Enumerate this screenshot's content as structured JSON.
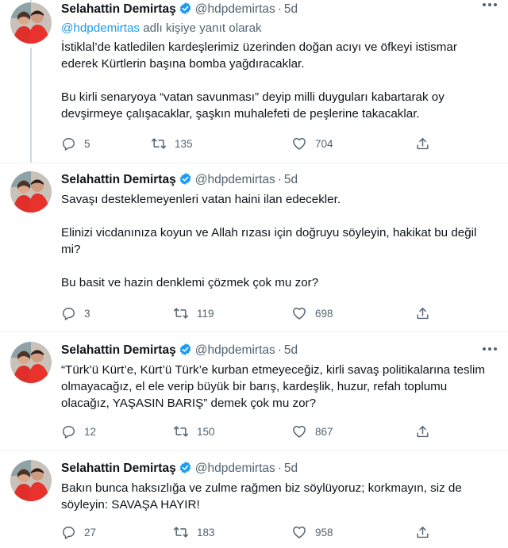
{
  "author": {
    "name": "Selahattin Demirtaş",
    "handle": "@hdpdemirtas",
    "time": "5d",
    "dot": "·"
  },
  "colors": {
    "link": "#1d9bf0",
    "verified": "#1d9bf0",
    "secondary": "#536471"
  },
  "tweets": [
    {
      "reply_to": {
        "handle": "@hdpdemirtas",
        "suffix": " adlı kişiye yanıt olarak"
      },
      "paragraphs": [
        "İstiklal’de katledilen kardeşlerimiz üzerinden doğan acıyı ve öfkeyi istismar ederek Kürtlerin başına bomba yağdıracaklar.",
        "Bu kirli senaryoya “vatan savunması” deyip milli duyguları kabartarak oy devşirmeye çalışacaklar, şaşkın muhalefeti de peşlerine takacaklar."
      ],
      "replies": "5",
      "retweets": "135",
      "likes": "704"
    },
    {
      "paragraphs": [
        "Savaşı desteklemeyenleri vatan haini ilan edecekler.",
        "Elinizi vicdanınıza koyun ve Allah rızası için doğruyu söyleyin, hakikat bu değil mi?",
        "Bu basit ve hazin denklemi çözmek çok mu zor?"
      ],
      "replies": "3",
      "retweets": "119",
      "likes": "698"
    },
    {
      "paragraphs": [
        "“Türk’ü Kürt’e, Kürt’ü Türk’e kurban etmeyeceğiz, kirli savaş politikalarına teslim olmayacağız, el ele verip büyük bir barış, kardeşlik, huzur, refah toplumu olacağız, YAŞASIN BARIŞ” demek çok mu zor?"
      ],
      "replies": "12",
      "retweets": "150",
      "likes": "867"
    },
    {
      "paragraphs": [
        "Bakın bunca haksızlığa ve zulme rağmen biz söylüyoruz; korkmayın, siz de söyleyin: SAVAŞA HAYIR!"
      ],
      "replies": "27",
      "retweets": "183",
      "likes": "958"
    }
  ]
}
